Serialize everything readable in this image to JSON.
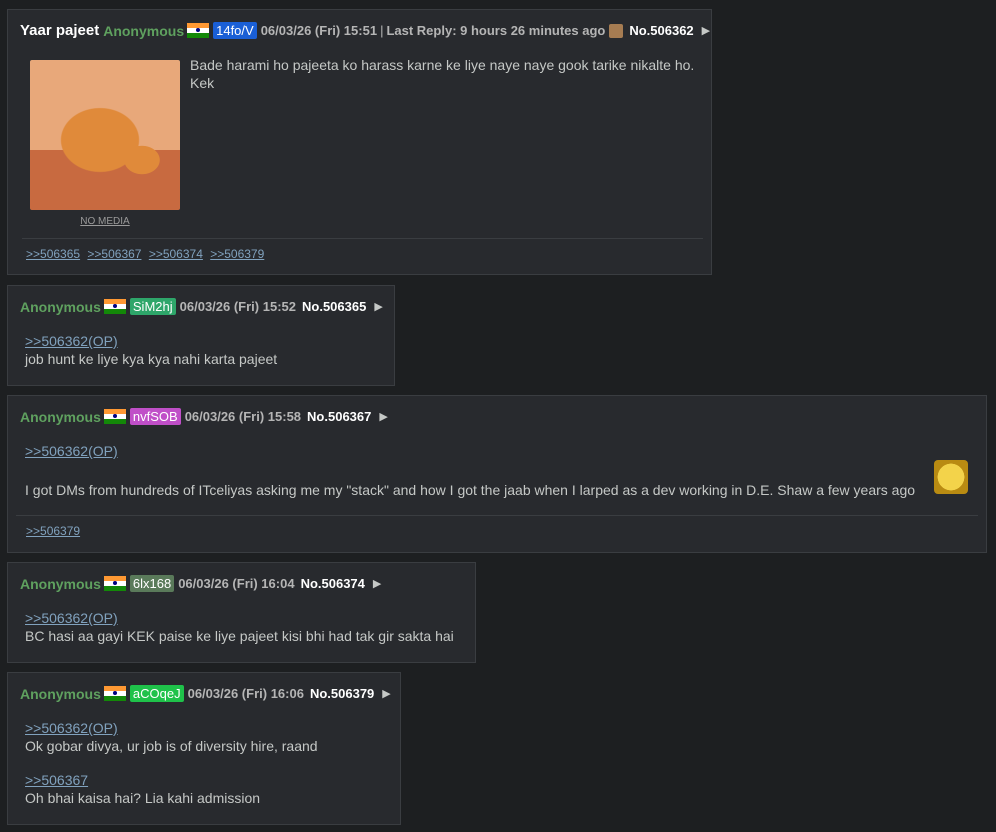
{
  "colors": {
    "background": "#1d1f21",
    "post_bg": "#282a2e",
    "name_green": "#5fa15f",
    "link_blue": "#81a2be"
  },
  "op": {
    "subject": "Yaar pajeet",
    "name": "Anonymous",
    "flag": "india-flag-icon",
    "uid": "14fo/V",
    "uid_color": "#1a5fd6",
    "date": "06/03/26 (Fri) 15:51",
    "separator": "|",
    "last_reply": "Last Reply: 9 hours 26 minutes ago",
    "post_no": "No.506362",
    "arrow": "▶",
    "body": "Bade harami ho pajeeta ko harass karne ke liye naye naye gook tarike nikalte ho. Kek",
    "no_media": "NO MEDIA",
    "backlinks": [
      ">>506365",
      ">>506367",
      ">>506374",
      ">>506379"
    ]
  },
  "replies": [
    {
      "name": "Anonymous",
      "uid": "SiM2hj",
      "uid_color": "#2ea66a",
      "date": "06/03/26 (Fri) 15:52",
      "post_no": "No.506365",
      "quote": ">>506362(OP)",
      "text": "job hunt ke liye kya kya nahi karta pajeet"
    },
    {
      "name": "Anonymous",
      "uid": "nvfSOB",
      "uid_color": "#c04fc8",
      "date": "06/03/26 (Fri) 15:58",
      "post_no": "No.506367",
      "quote": ">>506362(OP)",
      "text": "I got DMs from hundreds of ITceliyas asking me my \"stack\" and how I got the jaab when I larped as a dev working in D.E. Shaw a few years ago",
      "backlink": ">>506379"
    },
    {
      "name": "Anonymous",
      "uid": "6lx168",
      "uid_color": "#5a7a5a",
      "date": "06/03/26 (Fri) 16:04",
      "post_no": "No.506374",
      "quote": ">>506362(OP)",
      "text": "BC hasi aa gayi KEK paise ke liye pajeet kisi bhi had tak gir sakta hai"
    },
    {
      "name": "Anonymous",
      "uid": "aCOqeJ",
      "uid_color": "#1fc24a",
      "date": "06/03/26 (Fri) 16:06",
      "post_no": "No.506379",
      "quote": ">>506362(OP)",
      "text": "Ok gobar divya, ur job is of diversity hire, raand",
      "quote2": ">>506367",
      "text2": "Oh bhai kaisa hai? Lia kahi admission"
    }
  ]
}
